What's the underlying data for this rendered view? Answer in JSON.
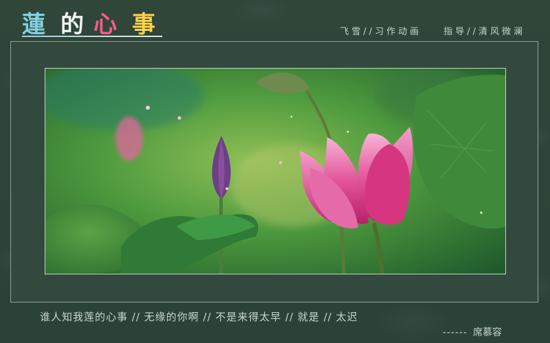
{
  "title": {
    "chars": [
      {
        "text": "蓮",
        "color": "#7fd2e2"
      },
      {
        "text": "的",
        "color": "#f2f2f2"
      },
      {
        "text": "心",
        "color": "#ff5a8a"
      },
      {
        "text": "事",
        "color": "#ffd24a"
      }
    ]
  },
  "credits": {
    "animation": "飞雪//习作动画",
    "guidance": "指导//清风微澜"
  },
  "poem": "谁人知我莲的心事  //  无缘的你啊  //  不是来得太早  //  就是  //  太迟",
  "author": {
    "dashes": "------",
    "name": "席慕容"
  },
  "colors": {
    "background": "#2d4437",
    "frame_border": "#8fa597",
    "text": "#c9d6cc",
    "lotus": "#e0468c"
  }
}
